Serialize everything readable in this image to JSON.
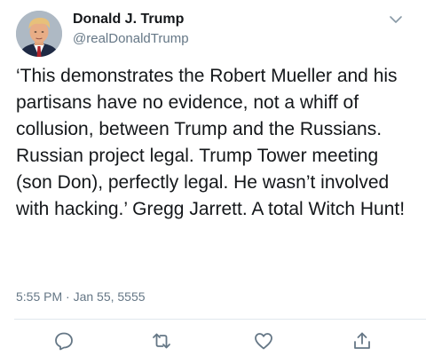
{
  "tweet": {
    "author": {
      "name": "Donald J. Trump",
      "handle": "@realDonaldTrump"
    },
    "text": "‘This demonstrates the Robert Mueller and his partisans have no evidence, not a whiff of collusion, between Trump and the Russians. Russian project legal. Trump Tower meeting (son Don), perfectly legal. He wasn’t involved with hacking.’ Gregg Jarrett. A total Witch Hunt!",
    "timestamp": "5:55 PM · Jan 55, 5555"
  },
  "icons": {
    "menu": "chevron-down-icon",
    "reply": "reply-icon",
    "retweet": "retweet-icon",
    "like": "heart-icon",
    "share": "share-icon"
  },
  "colors": {
    "text": "#14171a",
    "secondary": "#657786",
    "icon": "#657786",
    "divider": "#e1e8ed"
  }
}
